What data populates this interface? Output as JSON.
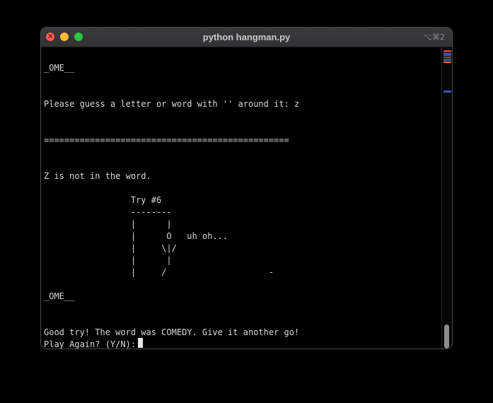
{
  "window": {
    "title": "python hangman.py",
    "shortcut": "⌥⌘2",
    "close_glyph": "×"
  },
  "terminal": {
    "lines": [
      "_OME__",
      "Please guess a letter or word with '' around it: z",
      "================================================",
      "Z is not in the word.",
      "                 Try #6",
      "                 --------",
      "                 |      |",
      "                 |      O   uh oh...",
      "                 |     \\|/",
      "                 |      |",
      "                 |     /                    -",
      "_OME__",
      "Good try! The word was COMEDY. Give it another go!",
      "Play Again? (Y/N): "
    ]
  },
  "colors": {
    "background": "#000000",
    "text": "#d8d8d8",
    "close": "#fe5f57",
    "minimize": "#febc2e",
    "maximize": "#28c840",
    "minimap_red": "#c0392b",
    "minimap_blue": "#2f5fb3",
    "minimap_orange": "#d9822b"
  }
}
